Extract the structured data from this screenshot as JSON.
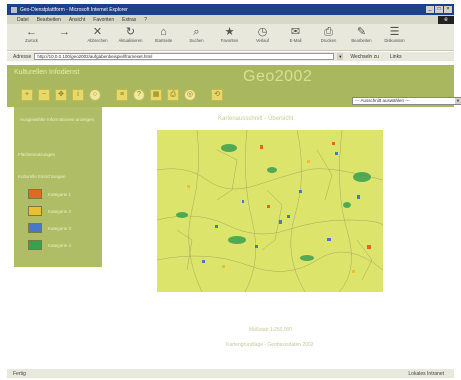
{
  "window": {
    "title": "Geo-Dienstplattform - Microsoft Internet Explorer",
    "controls": [
      "_",
      "□",
      "×"
    ]
  },
  "menu": [
    "Datei",
    "Bearbeiten",
    "Ansicht",
    "Favoriten",
    "Extras",
    "?"
  ],
  "toolbar": [
    {
      "label": "Zurück",
      "icon": "back-arrow-icon",
      "glyph": "←"
    },
    {
      "label": "",
      "icon": "forward-arrow-icon",
      "glyph": "→"
    },
    {
      "label": "Abbrechen",
      "icon": "stop-icon",
      "glyph": "✕"
    },
    {
      "label": "Aktualisieren",
      "icon": "refresh-icon",
      "glyph": "↻"
    },
    {
      "label": "Startseite",
      "icon": "home-icon",
      "glyph": "⌂"
    },
    {
      "label": "Suchen",
      "icon": "search-icon",
      "glyph": "⌕"
    },
    {
      "label": "Favoriten",
      "icon": "favorites-icon",
      "glyph": "★"
    },
    {
      "label": "Verlauf",
      "icon": "history-icon",
      "glyph": "◷"
    },
    {
      "label": "E-Mail",
      "icon": "mail-icon",
      "glyph": "✉"
    },
    {
      "label": "Drucken",
      "icon": "print-icon",
      "glyph": "⎙"
    },
    {
      "label": "Bearbeiten",
      "icon": "edit-icon",
      "glyph": "✎"
    },
    {
      "label": "Diskussion",
      "icon": "discuss-icon",
      "glyph": "☰"
    }
  ],
  "address": {
    "label": "Adresse",
    "url": "http://10.0.0.100/geo2002/aufgabenbeispiel/frameset.html",
    "go_label": "Wechseln zu",
    "links_label": "Links"
  },
  "app": {
    "dienst_title": "Kulturellen Infodienst",
    "brand": "Geo2002",
    "select_value": "--- Ausschnitt auswählen ---",
    "tool_icons": [
      "zoom-in-icon",
      "zoom-out-icon",
      "pan-icon",
      "info-icon",
      "select-icon",
      "layer-icon",
      "query-icon",
      "overview-icon",
      "print-map-icon",
      "help-icon",
      "reset-icon"
    ]
  },
  "sidebar": {
    "section1": "Ausgewählte Informationen anzeigen",
    "section2": "Flächennutzungen",
    "section3": "Kulturelle Einrichtungen",
    "legend": [
      {
        "label": "Kategorie 1",
        "color": "#e06820"
      },
      {
        "label": "Kategorie 2",
        "color": "#e8c030"
      },
      {
        "label": "Kategorie 3",
        "color": "#4878c8"
      },
      {
        "label": "Kategorie 4",
        "color": "#38a050"
      }
    ]
  },
  "map": {
    "title": "Kartenausschnitt - Übersicht",
    "footer1": "Maßstab 1:250.000",
    "footer2": "Kartengrundlage - Geobasisdaten 2002"
  },
  "status": {
    "text": "Fertig",
    "zone": "Lokales Intranet"
  },
  "colors": {
    "map_bg": "#dce46c",
    "header_bg": "#a9b85f",
    "sidebar_bg": "#aebd66",
    "orange": "#e06820",
    "blue": "#4878c8",
    "green": "#38a050"
  }
}
